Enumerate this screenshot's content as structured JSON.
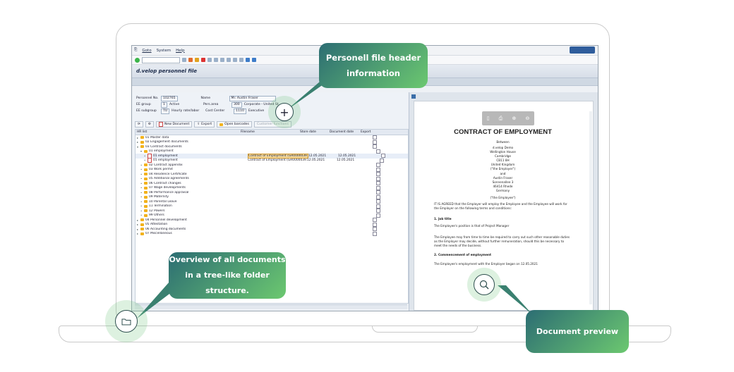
{
  "menu": {
    "items": [
      "Goto",
      "System",
      "Help"
    ]
  },
  "app_title": "d.velop personnel file",
  "header_fields": {
    "personnel_no_label": "Personnel No.",
    "personnel_no": "102765",
    "ee_group_label": "EE group",
    "ee_group_code": "1",
    "ee_group": "Active",
    "ee_subgroup_label": "EE subgroup",
    "ee_subgroup_code": "TU",
    "ee_subgroup": "Hourly rate/labor",
    "name_label": "Name",
    "name": "Mr. Austin Fraser",
    "pers_area_label": "Pers.area",
    "pers_area_code": "300",
    "pers_area": "Corporate - United St",
    "cost_center_label": "Cost Center",
    "cost_center": "1110",
    "cost_center_name": "Executive"
  },
  "buttons": {
    "new_document": "New Document",
    "export": "Export",
    "open_barcodes": "Open barcodes",
    "customer_functions": "Customer functions"
  },
  "table": {
    "columns": [
      "HR list",
      "Filename",
      "Store date",
      "Document date",
      "Export"
    ],
    "rows": [
      {
        "label": "01 Master data",
        "level": 0,
        "arrow": "▸",
        "type": "folder"
      },
      {
        "label": "02 Engagement documents",
        "level": 0,
        "arrow": "▸",
        "type": "folder"
      },
      {
        "label": "03 Contract documents",
        "level": 0,
        "arrow": "▾",
        "type": "folder"
      },
      {
        "label": "01 employment",
        "level": 1,
        "arrow": "▾",
        "type": "folder"
      },
      {
        "label": "01 employment",
        "level": 2,
        "arrow": "•",
        "type": "doc",
        "filename": "Contract of Employment (GR0000039...",
        "store_date": "12.05.2021",
        "doc_date": "12.05.2021",
        "highlight": true
      },
      {
        "label": "01 employment",
        "level": 2,
        "arrow": "•",
        "type": "doc",
        "filename": "Contract of Employment (GR0000039...",
        "store_date": "12.05.2021",
        "doc_date": "12.05.2021"
      },
      {
        "label": "02 Contract appendix",
        "level": 1,
        "arrow": "•",
        "type": "folder"
      },
      {
        "label": "03 Work permit",
        "level": 1,
        "arrow": "•",
        "type": "folder"
      },
      {
        "label": "04 Residence Certificate",
        "level": 1,
        "arrow": "•",
        "type": "folder"
      },
      {
        "label": "05 Additional agreements",
        "level": 1,
        "arrow": "•",
        "type": "folder"
      },
      {
        "label": "06 Contract changes",
        "level": 1,
        "arrow": "•",
        "type": "folder"
      },
      {
        "label": "07 Wage developments",
        "level": 1,
        "arrow": "•",
        "type": "folder"
      },
      {
        "label": "08 Performance appraisal",
        "level": 1,
        "arrow": "•",
        "type": "folder"
      },
      {
        "label": "09 Maternity",
        "level": 1,
        "arrow": "•",
        "type": "folder"
      },
      {
        "label": "10 Parental Leave",
        "level": 1,
        "arrow": "•",
        "type": "folder"
      },
      {
        "label": "11 Termination",
        "level": 1,
        "arrow": "•",
        "type": "folder"
      },
      {
        "label": "12 Powers",
        "level": 1,
        "arrow": "•",
        "type": "folder"
      },
      {
        "label": "99 Others",
        "level": 1,
        "arrow": "•",
        "type": "folder"
      },
      {
        "label": "04 Personnel development",
        "level": 0,
        "arrow": "▸",
        "type": "folder"
      },
      {
        "label": "05 Attestation",
        "level": 0,
        "arrow": "▸",
        "type": "folder"
      },
      {
        "label": "06 Accounting documents",
        "level": 0,
        "arrow": "▸",
        "type": "folder"
      },
      {
        "label": "07 Miscellaneous",
        "level": 0,
        "arrow": "▸",
        "type": "folder"
      }
    ]
  },
  "document": {
    "title": "CONTRACT OF EMPLOYMENT",
    "between": "Between",
    "employer_lines": [
      "d.velop Demo",
      "Wellington House",
      "Cambridge",
      "CB11 8H",
      "United Kingdom",
      "(\"the Employer\")"
    ],
    "and": "and",
    "employee_lines": [
      "Austin Fraser",
      "Sonnenallee 3",
      "46414 Rhede",
      "Germany"
    ],
    "employee_tag": "(\"the Employee\")",
    "agreed": "IT IS AGREED that the Employer will employ the Employee and the Employee will work for the Employer on the following terms and conditions:",
    "s1_title": "1.   Job title",
    "s1_text": "The Employee's position is that of Project Manager",
    "s1_text2": "The Employee may from time to time be required to carry out such other reasonable duties as the Employer may decide, without further remuneration, should this be necessary to meet the needs of the business.",
    "s2_title": "2.   Commencement of employment",
    "s2_text": "The Employee's employment with the Employer began on 12.05.2021"
  },
  "callouts": {
    "header": "Personell file header information",
    "overview": "Overview of all documents in a tree-like folder structure.",
    "preview": "Document preview"
  },
  "colors": {
    "callout_start": "#2c6d73",
    "callout_end": "#6cc870",
    "sap_blue": "#2f5d9c",
    "highlight": "#f7dca0"
  }
}
